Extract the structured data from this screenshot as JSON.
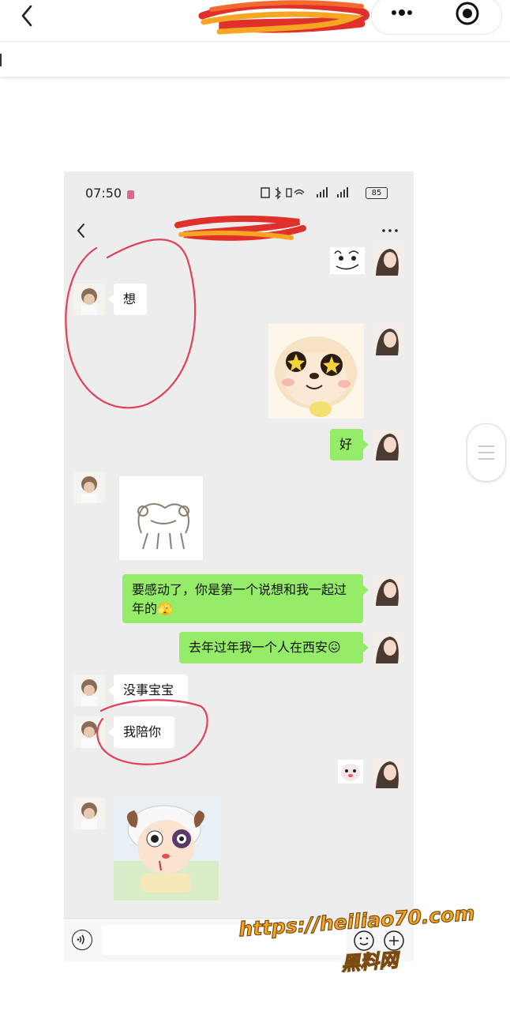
{
  "browser": {
    "back_icon": "chevron-left-icon",
    "more_icon": "three-dots-icon",
    "close_icon": "target-icon"
  },
  "status_bar": {
    "time": "07:50",
    "battery": "85"
  },
  "chat": {
    "messages": [
      {
        "side": "right",
        "type": "sticker",
        "desc": "sticker"
      },
      {
        "side": "left",
        "type": "text",
        "text": "想"
      },
      {
        "side": "right",
        "type": "sticker",
        "desc": "sticker"
      },
      {
        "side": "right",
        "type": "text",
        "text": "好"
      },
      {
        "side": "left",
        "type": "sticker",
        "desc": "sticker"
      },
      {
        "side": "right",
        "type": "text",
        "text": "要感动了，你是第一个说想和我一起过年的🫣"
      },
      {
        "side": "right",
        "type": "text",
        "text": "去年过年我一个人在西安😖"
      },
      {
        "side": "left",
        "type": "text",
        "text": "没事宝宝"
      },
      {
        "side": "left",
        "type": "text",
        "text": "我陪你"
      },
      {
        "side": "right",
        "type": "sticker",
        "desc": "sticker"
      },
      {
        "side": "left",
        "type": "sticker",
        "desc": "sticker"
      }
    ]
  },
  "watermark": {
    "url": "https://heiliao70.com",
    "name": "黑料网"
  },
  "colors": {
    "bubble_right": "#95ec69",
    "chat_bg": "#ededed",
    "annotation": "#e0405a",
    "watermark": "#f5a623"
  }
}
